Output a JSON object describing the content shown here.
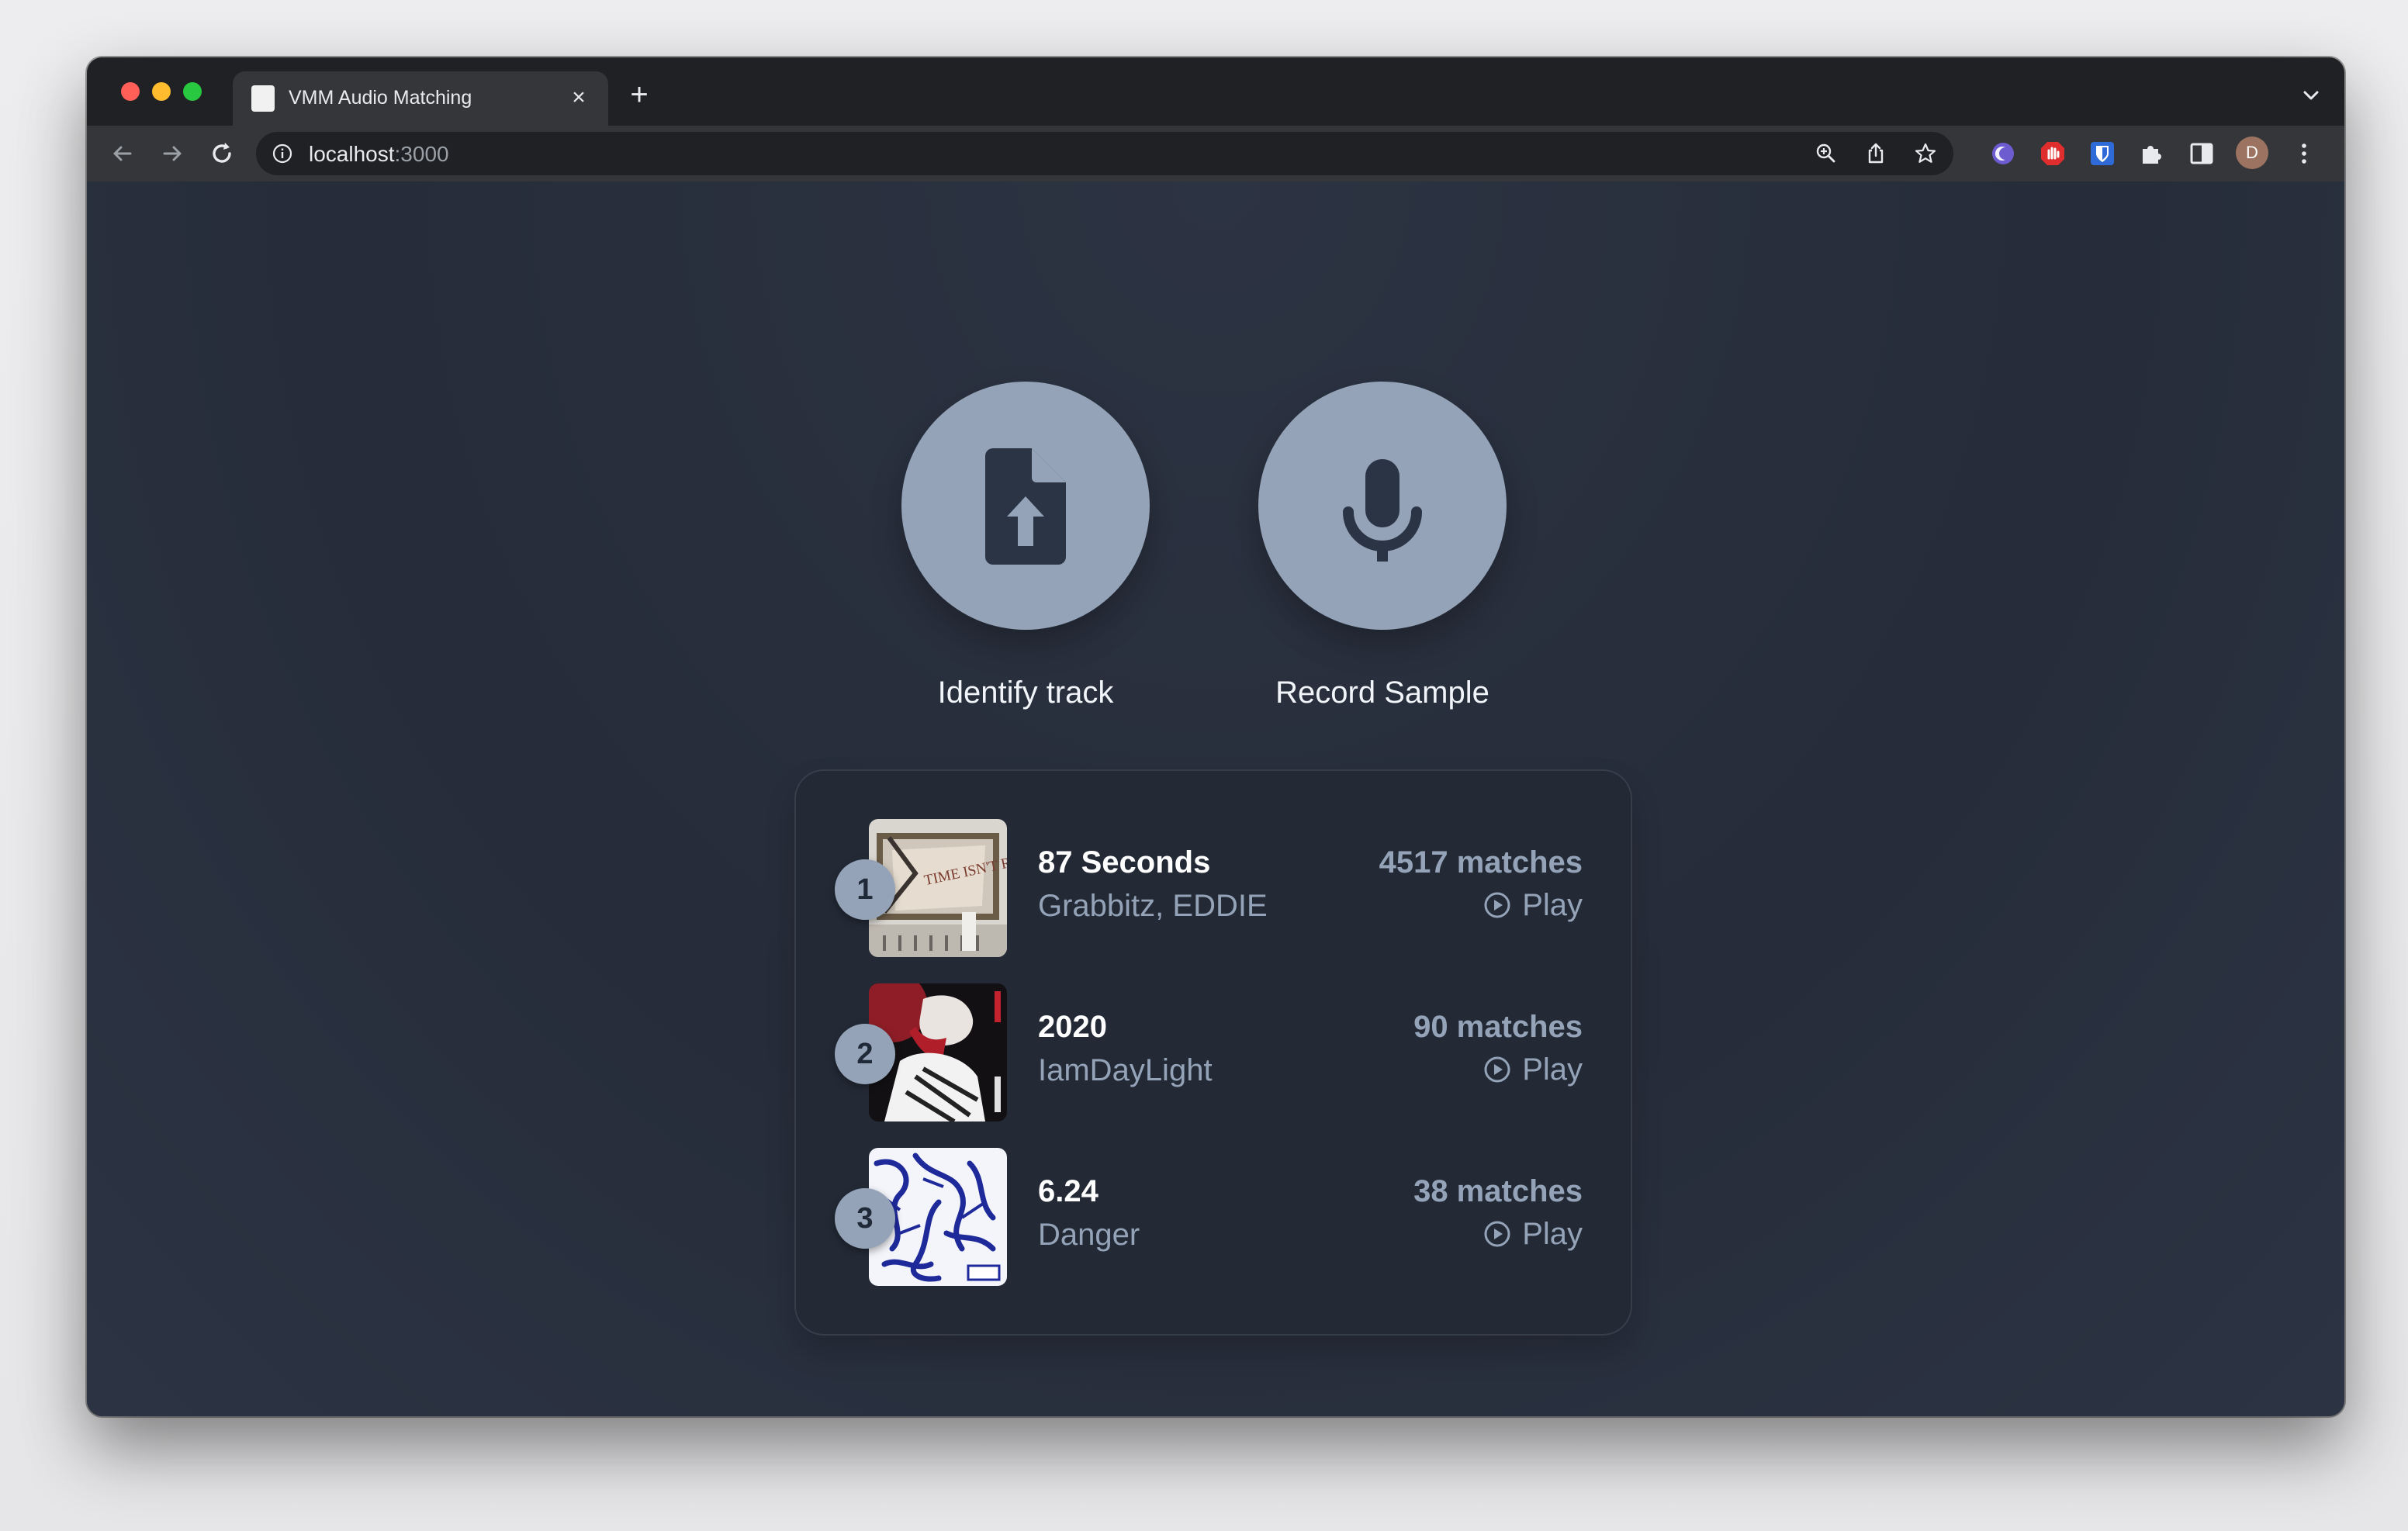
{
  "browser": {
    "tab_title": "VMM Audio Matching",
    "url_host": "localhost",
    "url_port": ":3000",
    "profile_initial": "D"
  },
  "actions": {
    "identify_label": "Identify track",
    "record_label": "Record Sample"
  },
  "results": [
    {
      "rank": "1",
      "title": "87 Seconds",
      "artist": "Grabbitz, EDDIE",
      "matches": "4517 matches",
      "play_label": "Play",
      "art_text": "TIME ISN'T REAL"
    },
    {
      "rank": "2",
      "title": "2020",
      "artist": "IamDayLight",
      "matches": "90 matches",
      "play_label": "Play"
    },
    {
      "rank": "3",
      "title": "6.24",
      "artist": "Danger",
      "matches": "38 matches",
      "play_label": "Play"
    }
  ],
  "colors": {
    "accent": "#94a3b8",
    "background": "#262c39",
    "panel": "#232a36"
  }
}
